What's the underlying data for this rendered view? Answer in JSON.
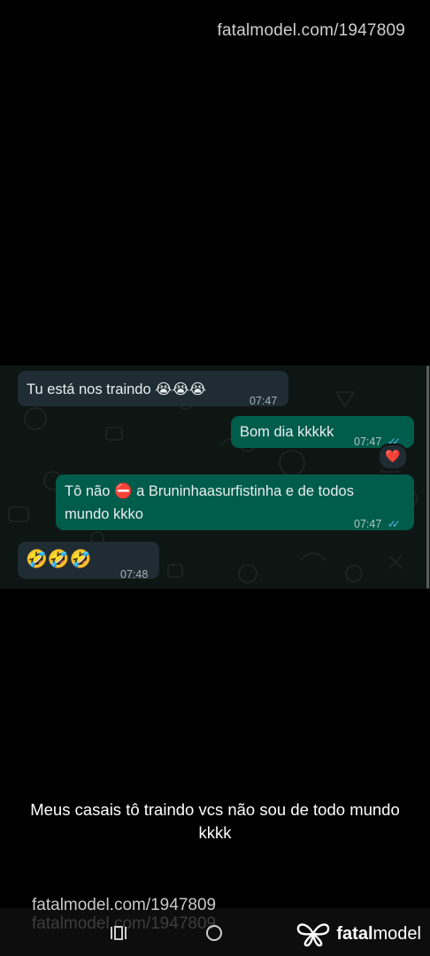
{
  "watermark": {
    "top": "fatalmodel.com/1947809",
    "bottom": "fatalmodel.com/1947809",
    "bottom_ghost": "fatalmodel.com/1947809"
  },
  "chat": {
    "messages": [
      {
        "direction": "incoming",
        "text": "Tu está nos traindo",
        "emojis": "😭😭😭",
        "time": "07:47"
      },
      {
        "direction": "outgoing",
        "text": "Bom dia kkkkk",
        "time": "07:47",
        "status": "✓✓",
        "reaction": "❤️"
      },
      {
        "direction": "outgoing",
        "text_part1": "Tô não",
        "emoji": "⛔",
        "text_part2": "a Bruninhaasurfistinha e de todos",
        "text_line2": "mundo kkko",
        "time": "07:47",
        "status": "✓✓"
      },
      {
        "direction": "incoming",
        "emojis": "🤣🤣🤣",
        "time": "07:48"
      }
    ]
  },
  "caption": "Meus casais tô traindo vcs não sou de todo mundo kkkk",
  "brand": {
    "strong": "fatal",
    "rest": "model"
  },
  "navbar": {
    "recents_icon": "recents-icon",
    "home_icon": "home-icon"
  },
  "colors": {
    "incoming": "#1f2c33",
    "outgoing": "#005c4b",
    "tick": "#53bdeb"
  }
}
